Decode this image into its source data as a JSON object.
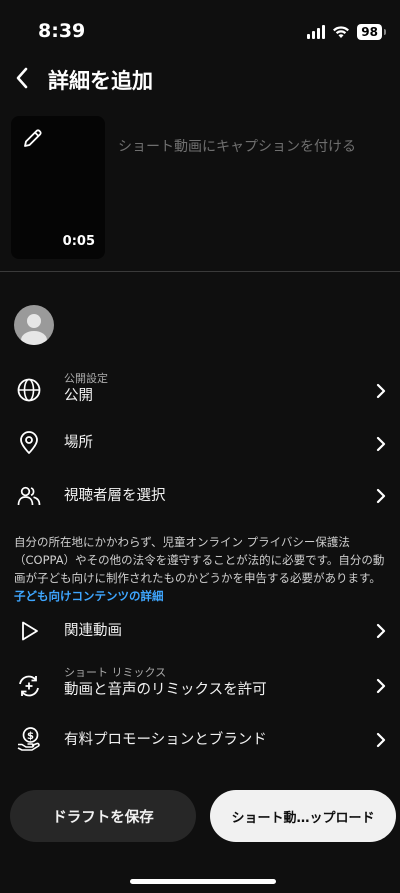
{
  "status_bar": {
    "time": "8:39",
    "battery": "98",
    "signal_icon": "signal-bars-icon",
    "wifi_icon": "wifi-icon"
  },
  "header": {
    "title": "詳細を追加",
    "back_icon": "chevron-left-icon"
  },
  "video": {
    "duration": "0:05",
    "edit_icon": "pencil-icon"
  },
  "caption": {
    "placeholder": "ショート動画にキャプションを付ける"
  },
  "settings": {
    "visibility": {
      "sublabel": "公開設定",
      "label": "公開",
      "icon": "globe-icon"
    },
    "location": {
      "label": "場所",
      "icon": "location-pin-icon"
    },
    "audience": {
      "label": "視聴者層を選択",
      "icon": "people-icon"
    }
  },
  "info": {
    "text": "自分の所在地にかかわらず、児童オンライン プライバシー保護法（COPPA）やその他の法令を遵守することが法的に必要です。自分の動画が子ども向けに制作されたものかどうかを申告する必要があります。",
    "link": "子ども向けコンテンツの詳細"
  },
  "more_settings": {
    "related": {
      "label": "関連動画",
      "icon": "play-outline-icon"
    },
    "remix": {
      "sublabel": "ショート リミックス",
      "label": "動画と音声のリミックスを許可",
      "icon": "remix-icon"
    },
    "promotion": {
      "label": "有料プロモーションとブランド",
      "icon": "paid-promotion-icon"
    }
  },
  "buttons": {
    "draft": "ドラフトを保存",
    "upload": "ショート動…ップロード"
  },
  "colors": {
    "background": "#0f0f0f",
    "link": "#3ea6ff",
    "upload_button": "#f1f1f1",
    "draft_button": "#272727"
  }
}
